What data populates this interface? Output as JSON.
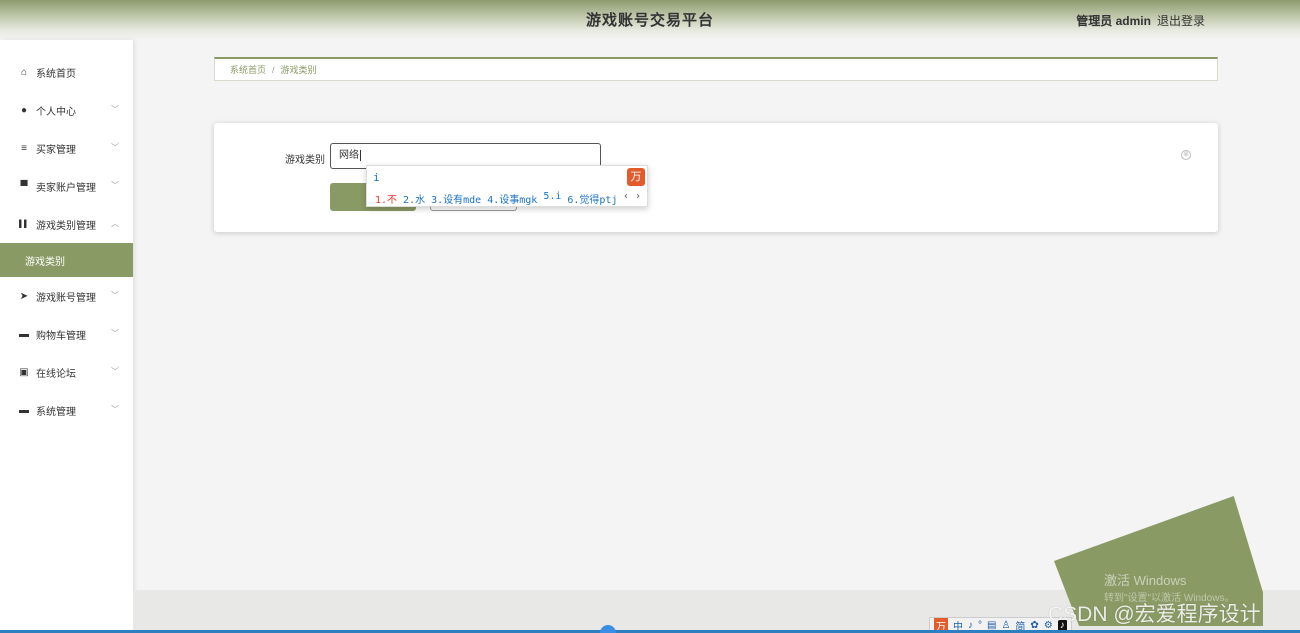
{
  "header": {
    "title": "游戏账号交易平台",
    "user": "管理员 admin",
    "logout": "退出登录"
  },
  "sidebar": {
    "items": [
      {
        "label": "系统首页",
        "icon": "home-icon",
        "glyph": "⌂"
      },
      {
        "label": "个人中心",
        "icon": "user-icon",
        "glyph": "●"
      },
      {
        "label": "买家管理",
        "icon": "list-icon",
        "glyph": "≡"
      },
      {
        "label": "卖家账户管理",
        "icon": "monitor-icon",
        "glyph": "▀"
      },
      {
        "label": "游戏类别管理",
        "icon": "book-icon",
        "glyph": "▌▌"
      },
      {
        "label": "游戏账号管理",
        "icon": "send-icon",
        "glyph": "➤"
      },
      {
        "label": "购物车管理",
        "icon": "desktop-icon",
        "glyph": "▬"
      },
      {
        "label": "在线论坛",
        "icon": "chart-icon",
        "glyph": "▣"
      },
      {
        "label": "系统管理",
        "icon": "laptop-icon",
        "glyph": "▬"
      }
    ],
    "subitem": "游戏类别"
  },
  "breadcrumb": {
    "home": "系统首页",
    "separator": "/",
    "current": "游戏类别"
  },
  "form": {
    "label": "游戏类别",
    "value": "网络"
  },
  "ime": {
    "input": "i",
    "candidates": [
      "1.不",
      "2.水",
      "3.设有mde",
      "4.设事mgk",
      "5.i",
      "6.觉得ptj"
    ],
    "pager": "‹ ›",
    "logo": "万"
  },
  "overlay": {
    "activate_title": "激活 Windows",
    "activate_sub": "转到\"设置\"以激活 Windows。",
    "watermark": "CSDN @宏爱程序设计"
  },
  "tray": {
    "items": [
      "万",
      "中",
      "♪",
      "°",
      "▤",
      "♙",
      "简",
      "✿",
      "⚙",
      "♪"
    ]
  },
  "colors": {
    "accent": "#8a9a64",
    "ime_blue": "#1a73c8",
    "ime_red": "#e33"
  }
}
